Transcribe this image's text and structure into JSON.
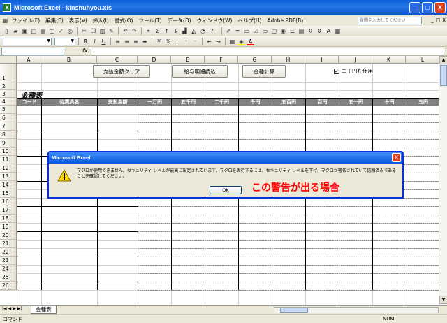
{
  "window": {
    "title": "Microsoft Excel - kinshuhyou.xls",
    "app_icon": "excel-icon",
    "minimize": "_",
    "maximize": "□",
    "close": "X"
  },
  "menu": {
    "items": [
      "ファイル(F)",
      "編集(E)",
      "表示(V)",
      "挿入(I)",
      "書式(O)",
      "ツール(T)",
      "データ(D)",
      "ウィンドウ(W)",
      "ヘルプ(H)",
      "Adobe PDF(B)"
    ],
    "help_placeholder": "質問を入力してください",
    "doc_controls": [
      "_",
      "□",
      "X"
    ]
  },
  "toolbar": {
    "zoom_icon": "zoom-icon",
    "font_size_combo": "",
    "font_combo": ""
  },
  "formula_bar": {
    "name_box": "",
    "fx_label": "fx",
    "value": ""
  },
  "sheet": {
    "columns": [
      "A",
      "B",
      "C",
      "D",
      "E",
      "F",
      "G",
      "H",
      "I",
      "J",
      "K",
      "L"
    ],
    "rows": [
      "1",
      "2",
      "3",
      "4",
      "5",
      "6",
      "7",
      "8",
      "9",
      "10",
      "11",
      "12",
      "13",
      "14",
      "15",
      "16",
      "17",
      "18",
      "19",
      "20",
      "21",
      "22",
      "23",
      "24",
      "25",
      "26"
    ],
    "buttons": {
      "clear": "支払金額クリア",
      "load": "給与明細読込",
      "calc": "金種計算"
    },
    "checkbox_label": "二千円札使用",
    "checkbox_checked": true,
    "title": "金種表",
    "headers": [
      "コード",
      "従業員名",
      "支払金額",
      "一万円",
      "五千円",
      "二千円",
      "千円",
      "五百円",
      "百円",
      "五十円",
      "十円",
      "五円"
    ]
  },
  "dialog": {
    "title": "Microsoft Excel",
    "message": "マクロが使用できません。セキュリティ レベルが最高に設定されています。マクロを実行するには、セキュリティ レベルを下げ、マクロが署名されていて信頼済みであることを確認してください。",
    "ok_label": "OK",
    "icon": "warning-icon",
    "close": "X"
  },
  "annotation": "この警告が出る場合",
  "tabs": {
    "active": "金種表",
    "nav_icons": [
      "first-sheet-icon",
      "prev-sheet-icon",
      "next-sheet-icon",
      "last-sheet-icon"
    ]
  },
  "status": {
    "mode": "コマンド",
    "num": "NUM"
  },
  "colors": {
    "header_fill": "#808080",
    "annotation_red": "#ff0000",
    "titlebar_blue": "#0a5fd8"
  }
}
